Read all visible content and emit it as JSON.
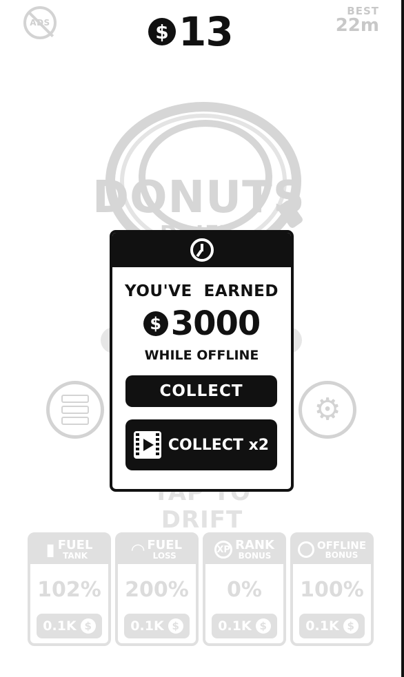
{
  "hud": {
    "no_ads_label": "ADS",
    "coin_symbol": "$",
    "currency_amount": "13",
    "best_label": "BEST",
    "best_value": "22m"
  },
  "background": {
    "logo_text": "DONUTS",
    "logo_subtext": "DRIFT",
    "tap_text": "TAP TO DRIFT"
  },
  "upgrades": [
    {
      "icon": "fuel-can-icon",
      "title": "FUEL",
      "subtitle": "TANK",
      "value": "102%",
      "cost": "0.1K",
      "coin": "$"
    },
    {
      "icon": "gauge-icon",
      "title": "FUEL",
      "subtitle": "LOSS",
      "value": "200%",
      "cost": "0.1K",
      "coin": "$"
    },
    {
      "icon": "xp-icon",
      "icon_text": "XP",
      "title": "RANK",
      "subtitle": "BONUS",
      "value": "0%",
      "cost": "0.1K",
      "coin": "$"
    },
    {
      "icon": "clock-icon",
      "title": "OFFLINE",
      "subtitle": "BONUS",
      "value": "100%",
      "cost": "0.1K",
      "coin": "$"
    }
  ],
  "modal": {
    "earned_label": "YOU'VE  EARNED",
    "coin_symbol": "$",
    "amount": "3000",
    "offline_label": "WHILE OFFLINE",
    "collect_label": "COLLECT",
    "collect_x2_label": "COLLECT x2"
  },
  "colors": {
    "primary": "#111111",
    "faded": "#d3d3d3",
    "background": "#ffffff"
  }
}
